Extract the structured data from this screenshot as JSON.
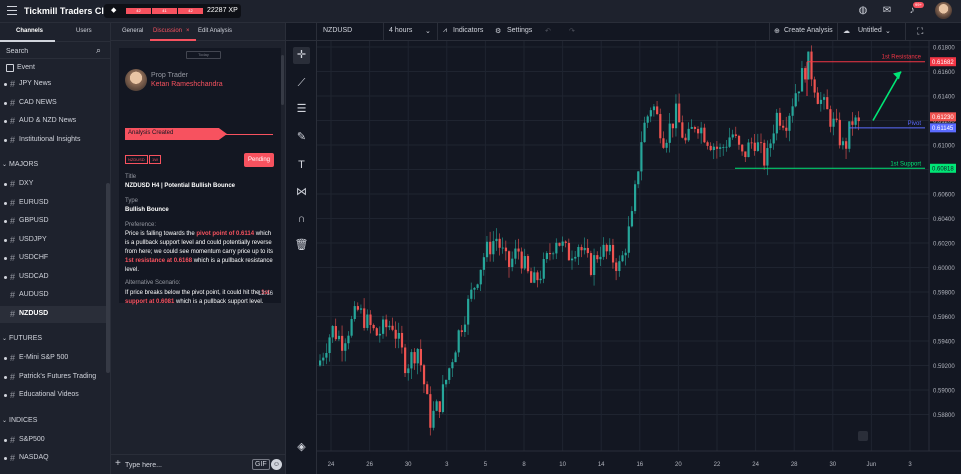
{
  "app": {
    "title": "Tickmill Traders Club",
    "xp_levels": [
      "42",
      "41",
      "42"
    ],
    "xp_value": "22287 XP",
    "notification_badge": "99+"
  },
  "sidebar": {
    "tabs": [
      "Channels",
      "Users"
    ],
    "search_placeholder": "Search",
    "event_label": "Event",
    "items": [
      {
        "kind": "item",
        "label": "JPY News",
        "dot": true
      },
      {
        "kind": "item",
        "label": "CAD NEWS",
        "dot": true
      },
      {
        "kind": "item",
        "label": "AUD & NZD News",
        "dot": true
      },
      {
        "kind": "item",
        "label": "Institutional Insights",
        "dot": true
      },
      {
        "kind": "group",
        "label": "MAJORS"
      },
      {
        "kind": "item",
        "label": "DXY",
        "dot": true
      },
      {
        "kind": "item",
        "label": "EURUSD",
        "dot": true
      },
      {
        "kind": "item",
        "label": "GBPUSD",
        "dot": true
      },
      {
        "kind": "item",
        "label": "USDJPY",
        "dot": true
      },
      {
        "kind": "item",
        "label": "USDCHF",
        "dot": true
      },
      {
        "kind": "item",
        "label": "USDCAD",
        "dot": true
      },
      {
        "kind": "item",
        "label": "AUDUSD",
        "dot": false
      },
      {
        "kind": "item",
        "label": "NZDUSD",
        "dot": false,
        "selected": true
      },
      {
        "kind": "group",
        "label": "FUTURES"
      },
      {
        "kind": "item",
        "label": "E-Mini S&P 500",
        "dot": true
      },
      {
        "kind": "item",
        "label": "Patrick's Futures Trading",
        "dot": true
      },
      {
        "kind": "item",
        "label": "Educational Videos",
        "dot": true
      },
      {
        "kind": "group",
        "label": "INDICES"
      },
      {
        "kind": "item",
        "label": "S&P500",
        "dot": true
      },
      {
        "kind": "item",
        "label": "NASDAQ",
        "dot": true
      }
    ]
  },
  "panel": {
    "tabs": [
      "General",
      "Discussion",
      "Edit Analysis"
    ],
    "close_glyph": "×",
    "chip": "Today",
    "author_role": "Prop Trader",
    "author_name": "Ketan Rameshchandra",
    "created_label": "Analysis Created",
    "tags": [
      "NZDUSD",
      "1W"
    ],
    "status": "Pending",
    "title_label": "Title",
    "title_value": "NZDUSD H4 | Potential Bullish Bounce",
    "type_label": "Type",
    "type_value": "Bullish Bounce",
    "preference_label": "Preference:",
    "pref_1": "Price is falling towards the ",
    "pref_hl1": "pivot point of 0.6114",
    "pref_2": " which is a pullback support level and could potentially reverse from here; we could see momentum carry price up to its ",
    "pref_hl2": "1st resistance at 0.6168",
    "pref_3": " which is a pullback resistance level.",
    "alt_label": "Alternative Scenario:",
    "alt_1": "If price breaks below the pivot point, it could hit the ",
    "alt_hl": "1st support at 0.6081",
    "alt_2": " which is a pullback support level.",
    "time": "12:16",
    "reply_placeholder": "Type here...",
    "gif_label": "GIF"
  },
  "chart_toolbar": {
    "symbol": "NZDUSD",
    "interval": "4 hours",
    "indicators": "Indicators",
    "settings": "Settings",
    "create_analysis": "Create Analysis",
    "layout_name": "Untitled"
  },
  "chart_data": {
    "type": "candlestick",
    "symbol": "NZDUSD",
    "interval": "4 hours",
    "ylim": [
      0.586,
      0.618
    ],
    "y_ticks": [
      "0.61800",
      "0.61600",
      "0.61400",
      "0.61200",
      "0.61000",
      "0.60800",
      "0.60600",
      "0.60400",
      "0.60200",
      "0.60000",
      "0.59800",
      "0.59600",
      "0.59400",
      "0.59200",
      "0.59000",
      "0.58800"
    ],
    "x_ticks": [
      "24",
      "26",
      "30",
      "3",
      "5",
      "8",
      "10",
      "14",
      "16",
      "20",
      "22",
      "24",
      "28",
      "30",
      "Jun",
      "3"
    ],
    "path": [
      [
        0.592,
        0
      ],
      [
        0.595,
        14
      ],
      [
        0.594,
        24
      ],
      [
        0.5965,
        40
      ],
      [
        0.5945,
        58
      ],
      [
        0.5955,
        74
      ],
      [
        0.592,
        88
      ],
      [
        0.5935,
        100
      ],
      [
        0.5875,
        112
      ],
      [
        0.589,
        122
      ],
      [
        0.5945,
        140
      ],
      [
        0.5975,
        152
      ],
      [
        0.601,
        166
      ],
      [
        0.6025,
        178
      ],
      [
        0.6,
        190
      ],
      [
        0.6015,
        200
      ],
      [
        0.5985,
        214
      ],
      [
        0.6,
        226
      ],
      [
        0.6025,
        238
      ],
      [
        0.601,
        250
      ],
      [
        0.602,
        260
      ],
      [
        0.6,
        272
      ],
      [
        0.6015,
        282
      ],
      [
        0.601,
        292
      ],
      [
        0.6,
        302
      ],
      [
        0.604,
        314
      ],
      [
        0.611,
        324
      ],
      [
        0.6135,
        334
      ],
      [
        0.6105,
        346
      ],
      [
        0.6125,
        358
      ],
      [
        0.61,
        368
      ],
      [
        0.612,
        378
      ],
      [
        0.6105,
        390
      ],
      [
        0.6095,
        402
      ],
      [
        0.611,
        414
      ],
      [
        0.609,
        424
      ],
      [
        0.6105,
        436
      ],
      [
        0.6085,
        448
      ],
      [
        0.6125,
        458
      ],
      [
        0.612,
        468
      ],
      [
        0.6145,
        478
      ],
      [
        0.616,
        486
      ],
      [
        0.6168,
        490
      ],
      [
        0.614,
        500
      ],
      [
        0.6125,
        510
      ],
      [
        0.611,
        520
      ],
      [
        0.6095,
        526
      ],
      [
        0.612,
        534
      ],
      [
        0.6115,
        542
      ]
    ],
    "levels": [
      {
        "label": "1st Resistance",
        "value": 0.6168,
        "tag": "0.61682",
        "color": "#f23645"
      },
      {
        "label": "Pivot",
        "value": 0.6114,
        "tag": "0.61145",
        "color": "#5b6bff"
      },
      {
        "label": "1st Support",
        "value": 0.6081,
        "tag": "0.60818",
        "color": "#00e676"
      }
    ],
    "last_price_tag": "0.61230",
    "colors": {
      "up": "#26a69a",
      "down": "#ef5350",
      "arrow": "#00e676"
    }
  }
}
